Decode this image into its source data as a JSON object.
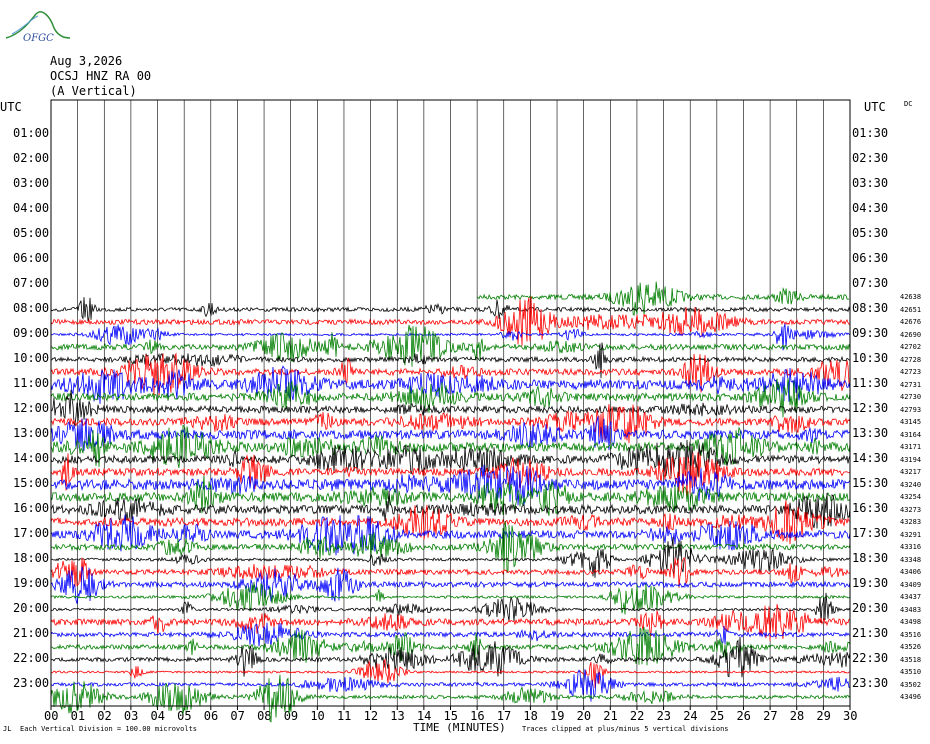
{
  "logo_text": "OFGC",
  "header": {
    "date": "Aug 3,2026",
    "station": "OCSJ HNZ RA 00",
    "component": "(A Vertical)"
  },
  "left_axis": {
    "title": "UTC",
    "hours": [
      "01:00",
      "02:00",
      "03:00",
      "04:00",
      "05:00",
      "06:00",
      "07:00",
      "08:00",
      "09:00",
      "10:00",
      "11:00",
      "12:00",
      "13:00",
      "14:00",
      "15:00",
      "16:00",
      "17:00",
      "18:00",
      "19:00",
      "20:00",
      "21:00",
      "22:00",
      "23:00"
    ]
  },
  "right_axis": {
    "title": "UTC",
    "dc": "DC",
    "hours": [
      "01:30",
      "02:30",
      "03:30",
      "04:30",
      "05:30",
      "06:30",
      "07:30",
      "08:30",
      "09:30",
      "10:30",
      "11:30",
      "12:30",
      "13:30",
      "14:30",
      "15:30",
      "16:30",
      "17:30",
      "18:30",
      "19:30",
      "20:30",
      "21:30",
      "22:30",
      "23:30"
    ]
  },
  "counts": [
    "42638",
    "42651",
    "42676",
    "42690",
    "42702",
    "42728",
    "42723",
    "42731",
    "42730",
    "42793",
    "43145",
    "43164",
    "43171",
    "43194",
    "43217",
    "43240",
    "43254",
    "43273",
    "43283",
    "43291",
    "43316",
    "43348",
    "43406",
    "43409",
    "43437",
    "43483",
    "43498",
    "43516",
    "43526",
    "43518",
    "43510",
    "43502",
    "43496"
  ],
  "x_axis": {
    "ticks": [
      "00",
      "01",
      "02",
      "03",
      "04",
      "05",
      "06",
      "07",
      "08",
      "09",
      "10",
      "11",
      "12",
      "13",
      "14",
      "15",
      "16",
      "17",
      "18",
      "19",
      "20",
      "21",
      "22",
      "23",
      "24",
      "25",
      "26",
      "27",
      "28",
      "29",
      "30"
    ],
    "title": "TIME (MINUTES)"
  },
  "footer": {
    "corner": "JL",
    "division_note": "Each Vertical Division =  100.00 microvolts",
    "clip_note": "Traces clipped at plus/minus 5 vertical divisions"
  },
  "colors": {
    "black": "#000000",
    "red": "#ff0000",
    "blue": "#0000ff",
    "green": "#007f00",
    "logo": "#2f8f3a"
  },
  "chart_data": {
    "type": "seismogram",
    "title": "OCSJ HNZ RA 00 (A Vertical)",
    "date": "Aug 3,2026",
    "xlabel": "TIME (MINUTES)",
    "xlim": [
      0,
      30
    ],
    "rows_per_hour": 2,
    "trace_colors_cycle": [
      "black",
      "red",
      "blue",
      "green"
    ],
    "first_trace_start": {
      "hour_utc": "07:30",
      "minute": 16
    },
    "traces_with_data": 33,
    "clip": "plus/minus 5 vertical divisions",
    "vertical_division": "100.00 microvolts",
    "row_count_labels": [
      42638,
      42651,
      42676,
      42690,
      42702,
      42728,
      42723,
      42731,
      42730,
      42793,
      43145,
      43164,
      43171,
      43194,
      43217,
      43240,
      43254,
      43273,
      43283,
      43291,
      43316,
      43348,
      43406,
      43409,
      43437,
      43483,
      43498,
      43516,
      43526,
      43518,
      43510,
      43502,
      43496
    ]
  }
}
